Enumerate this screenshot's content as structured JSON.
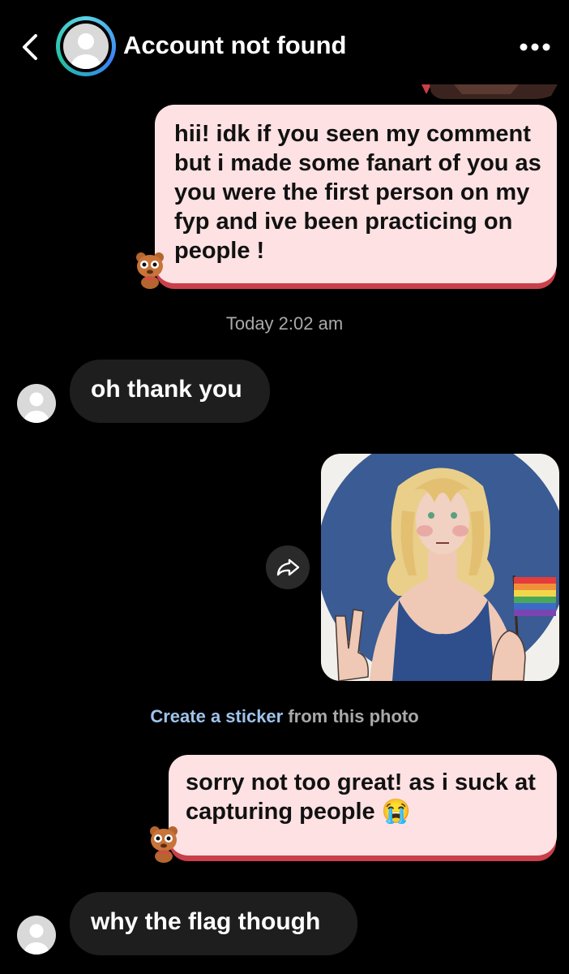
{
  "header": {
    "title": "Account not found",
    "icons": {
      "back": "chevron-left-icon",
      "more": "more-horizontal-icon"
    },
    "ring_colors": [
      "#5ad2e6",
      "#3b82f6",
      "#22c1a4"
    ]
  },
  "messages": {
    "sent_1": "hii! idk if you seen my comment but i made some fanart of you as you were the first person on my fyp and ive been practicing on people !",
    "timestamp": "Today 2:02 am",
    "received_1": "oh thank you",
    "sticker_prompt": {
      "link": "Create a sticker",
      "rest": " from this photo"
    },
    "sent_2_text": "sorry not too great! as i suck at capturing people ",
    "sent_2_emoji": "😭",
    "received_2": "why the flag though"
  },
  "colors": {
    "sent_bubble_bg": "#fde1e3",
    "sent_bubble_underline": "#c9404a",
    "received_bubble_bg": "#1e1e1e",
    "link": "#9ec3ec",
    "meta_text": "#a9a9a9",
    "background": "#000000"
  }
}
